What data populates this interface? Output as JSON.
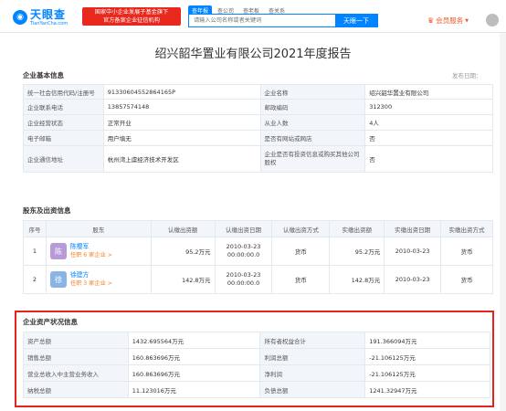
{
  "header": {
    "logo_text": "天眼查",
    "logo_subtext": "TianYanCha.com",
    "gov_badge_line1": "国家中小企业发展子基金旗下",
    "gov_badge_line2": "官方备案企业征信机构",
    "search_tabs": [
      "查年报",
      "查公司",
      "查老板",
      "查关系"
    ],
    "search_placeholder": "请输入公司名称或者关键词",
    "search_button": "天眼一下",
    "vip_label": "会员服务"
  },
  "report_title": "绍兴韶华置业有限公司2021年度报告",
  "basic_info": {
    "section_title": "企业基本信息",
    "publish_date": "发布日期：",
    "rows": [
      [
        "统一社会信用代码/注册号",
        "91330604552864165P",
        "企业名称",
        "绍兴韶华置业有限公司"
      ],
      [
        "企业联系电话",
        "13857574148",
        "邮政编码",
        "312300"
      ],
      [
        "企业经营状态",
        "正常开业",
        "从业人数",
        "4人"
      ],
      [
        "电子邮箱",
        "用户填无",
        "是否有网站或网店",
        "否"
      ],
      [
        "企业通信地址",
        "杭州湾上虞经济技术开发区",
        "企业是否有投资信息或购买其他公司股权",
        "否"
      ]
    ]
  },
  "shareholders": {
    "section_title": "股东及出资信息",
    "headers": [
      "序号",
      "股东",
      "认缴出资额",
      "认缴出资日期",
      "认缴出资方式",
      "实缴出资额",
      "实缴出资日期",
      "实缴出资方式"
    ],
    "rows": [
      {
        "index": "1",
        "avatar_char": "陈",
        "avatar_color": "#b79ad8",
        "name": "陈樱军",
        "role": "任职 6 家企业 >",
        "sub_amount": "95.2万元",
        "sub_date_1": "2010-03-23",
        "sub_date_2": "00:00:00.0",
        "sub_method": "货币",
        "paid_amount": "95.2万元",
        "paid_date": "2010-03-23",
        "paid_method": "货币"
      },
      {
        "index": "2",
        "avatar_char": "徐",
        "avatar_color": "#8bb4e6",
        "name": "徐建方",
        "role": "任职 3 家企业 >",
        "sub_amount": "142.8万元",
        "sub_date_1": "2010-03-23",
        "sub_date_2": "00:00:00.0",
        "sub_method": "货币",
        "paid_amount": "142.8万元",
        "paid_date": "2010-03-23",
        "paid_method": "货币"
      }
    ]
  },
  "assets": {
    "section_title": "企业资产状况信息",
    "rows": [
      [
        "资产总额",
        "1432.695564万元",
        "所有者权益合计",
        "191.366094万元"
      ],
      [
        "销售总额",
        "160.863696万元",
        "利润总额",
        "-21.106125万元"
      ],
      [
        "营业总收入中主营业务收入",
        "160.863696万元",
        "净利润",
        "-21.106125万元"
      ],
      [
        "纳税总额",
        "11.123016万元",
        "负债总额",
        "1241.32947万元"
      ]
    ]
  },
  "colors": {
    "brand": "#0084ff",
    "highlight_border": "#e4241c",
    "vip": "#e85c26",
    "role": "#f48020"
  }
}
